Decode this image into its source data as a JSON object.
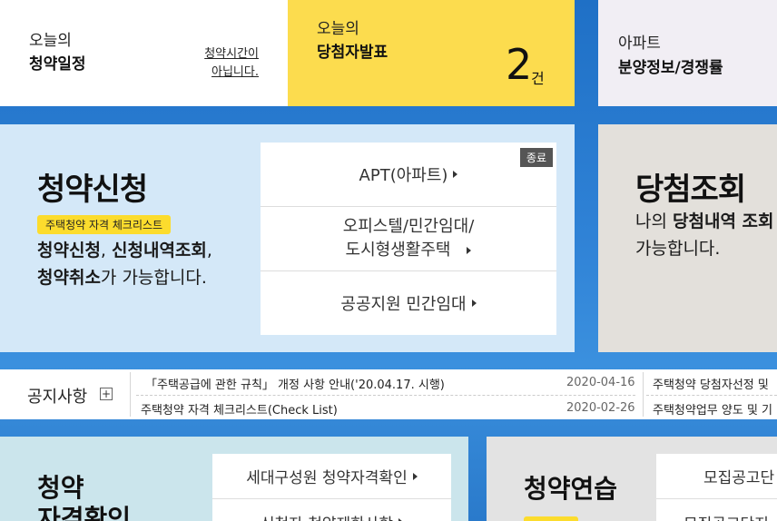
{
  "top": {
    "schedule": {
      "line1": "오늘의",
      "line2": "청약일정",
      "note1": "청약시간이",
      "note2": "아닙니다."
    },
    "winner": {
      "line1": "오늘의",
      "line2": "당첨자발표",
      "count": "2",
      "unit": "건"
    },
    "apt": {
      "line1": "아파트",
      "line2": "분양정보/경쟁률"
    }
  },
  "apply": {
    "title": "청약신청",
    "badge": "주택청약 자격 체크리스트",
    "desc": {
      "b1": "청약신청",
      "t1": ", ",
      "b2": "신청내역조회",
      "t2": ",",
      "b3": "청약취소",
      "t3": "가 가능합니다."
    },
    "menu": {
      "end_tag": "종료",
      "items": [
        {
          "label": "APT(아파트)"
        },
        {
          "label_line1": "오피스텔/민간임대/",
          "label_line2": "도시형생활주택"
        },
        {
          "label": "공공지원 민간임대"
        }
      ]
    }
  },
  "lookup": {
    "title": "당첨조회",
    "desc_t1": "나의 ",
    "desc_b1": "당첨내역 조회",
    "desc_line2": "가능합니다."
  },
  "notice": {
    "title": "공지사항",
    "plus": "+",
    "left_items": [
      {
        "title": "「주택공급에 관한 규칙」 개정 사항 안내('20.04.17. 시행)",
        "date": "2020-04-16"
      },
      {
        "title": "주택청약 자격 체크리스트(Check List)",
        "date": "2020-02-26"
      }
    ],
    "right_items": [
      {
        "title": "주택청약 당첨자선정 및"
      },
      {
        "title": "주택청약업무 양도 및 기"
      }
    ]
  },
  "bottom": {
    "qual": {
      "title_line1": "청약",
      "title_line2": "자격확인",
      "menu": [
        {
          "label": "세대구성원 청약자격확인"
        },
        {
          "label": "신청자 청약제한사항"
        }
      ]
    },
    "practice": {
      "title": "청약연습",
      "menu": [
        {
          "label": "모집공고단"
        },
        {
          "label": "모집공고단지"
        }
      ]
    }
  },
  "colors": {
    "yellow": "#fcdc4e",
    "blue_bg": "#2f82d6",
    "apply_bg": "#d4e8f8",
    "lookup_bg": "#e3e0db"
  }
}
